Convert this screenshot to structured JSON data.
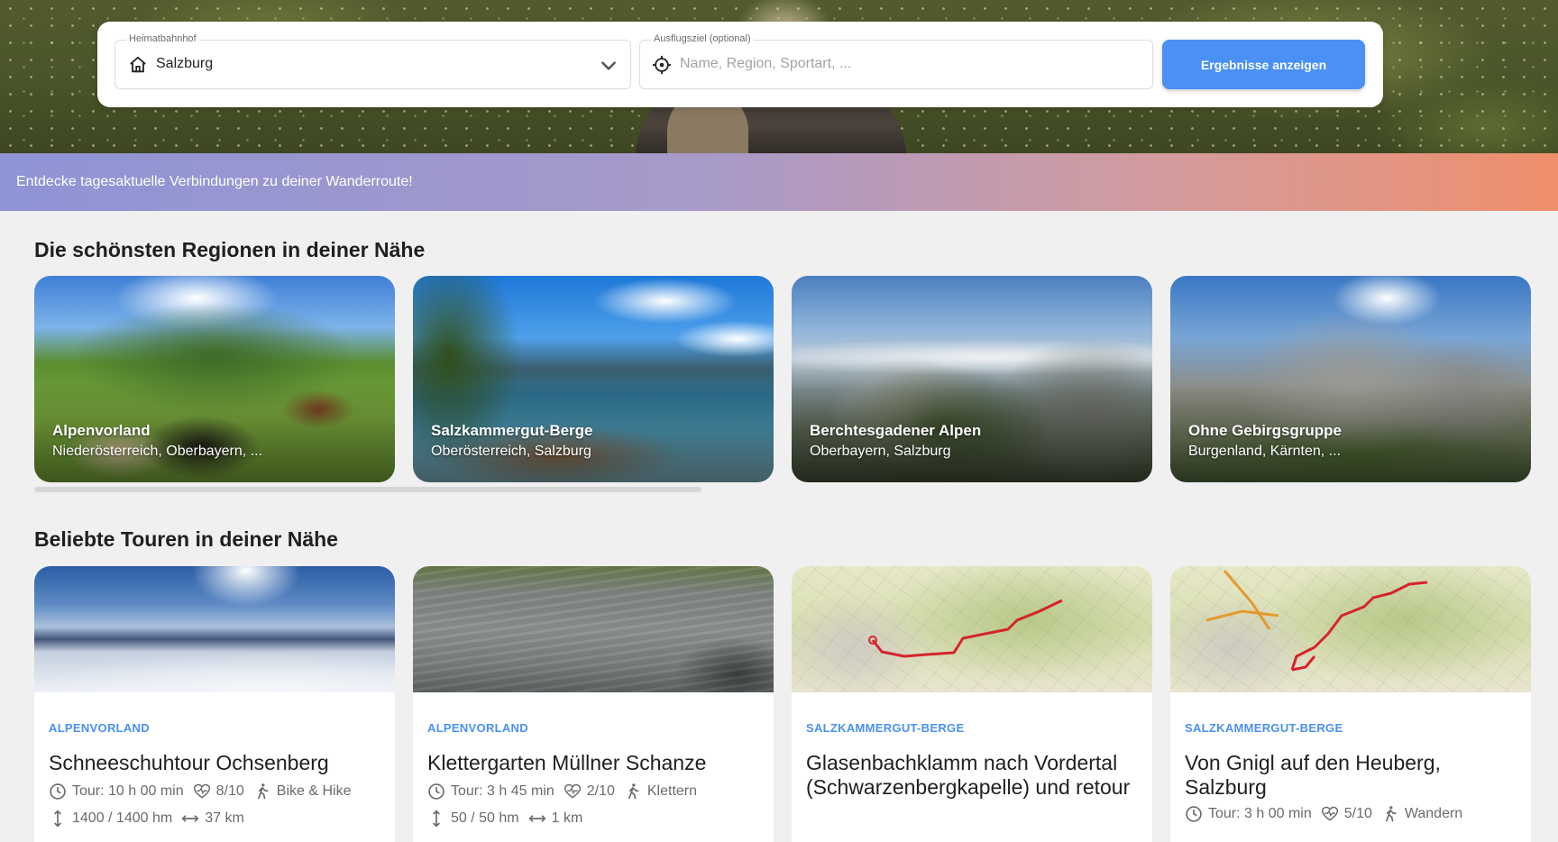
{
  "search": {
    "home_label": "Heimatbahnhof",
    "home_value": "Salzburg",
    "dest_label": "Ausflugsziel (optional)",
    "dest_placeholder": "Name, Region, Sportart, ...",
    "submit_label": "Ergebnisse anzeigen"
  },
  "banner": {
    "text": "Entdecke tagesaktuelle Verbindungen zu deiner Wanderroute!"
  },
  "regions": {
    "title": "Die schönsten Regionen in deiner Nähe",
    "items": [
      {
        "name": "Alpenvorland",
        "sub": "Niederösterreich, Oberbayern, ..."
      },
      {
        "name": "Salzkammergut-Berge",
        "sub": "Oberösterreich, Salzburg"
      },
      {
        "name": "Berchtesgadener Alpen",
        "sub": "Oberbayern, Salzburg"
      },
      {
        "name": "Ohne Gebirgsgruppe",
        "sub": "Burgenland, Kärnten, ..."
      }
    ]
  },
  "tours": {
    "title": "Beliebte Touren in deiner Nähe",
    "items": [
      {
        "region": "ALPENVORLAND",
        "title": "Schneeschuhtour Ochsenberg",
        "duration": "Tour: 10 h 00 min",
        "difficulty": "8/10",
        "sport": "Bike & Hike",
        "elevation": "1400 / 1400 hm",
        "distance": "37 km"
      },
      {
        "region": "ALPENVORLAND",
        "title": "Klettergarten Müllner Schanze",
        "duration": "Tour: 3 h 45 min",
        "difficulty": "2/10",
        "sport": "Klettern",
        "elevation": "50 / 50 hm",
        "distance": "1 km"
      },
      {
        "region": "SALZKAMMERGUT-BERGE",
        "title": "Glasenbachklamm nach Vordertal (Schwarzenbergkapelle) und retour"
      },
      {
        "region": "SALZKAMMERGUT-BERGE",
        "title": "Von Gnigl auf den Heuberg, Salzburg",
        "duration": "Tour: 3 h 00 min",
        "difficulty": "5/10",
        "sport": "Wandern"
      }
    ]
  },
  "colors": {
    "accent": "#4a90f5",
    "banner_start": "#8e94d6",
    "banner_end": "#ef8f6c",
    "background": "#f0f0f0"
  },
  "icons": [
    "home-icon",
    "chevron-down-icon",
    "target-icon",
    "clock-icon",
    "heart-pulse-icon",
    "hiker-icon",
    "elevation-icon",
    "distance-icon"
  ]
}
